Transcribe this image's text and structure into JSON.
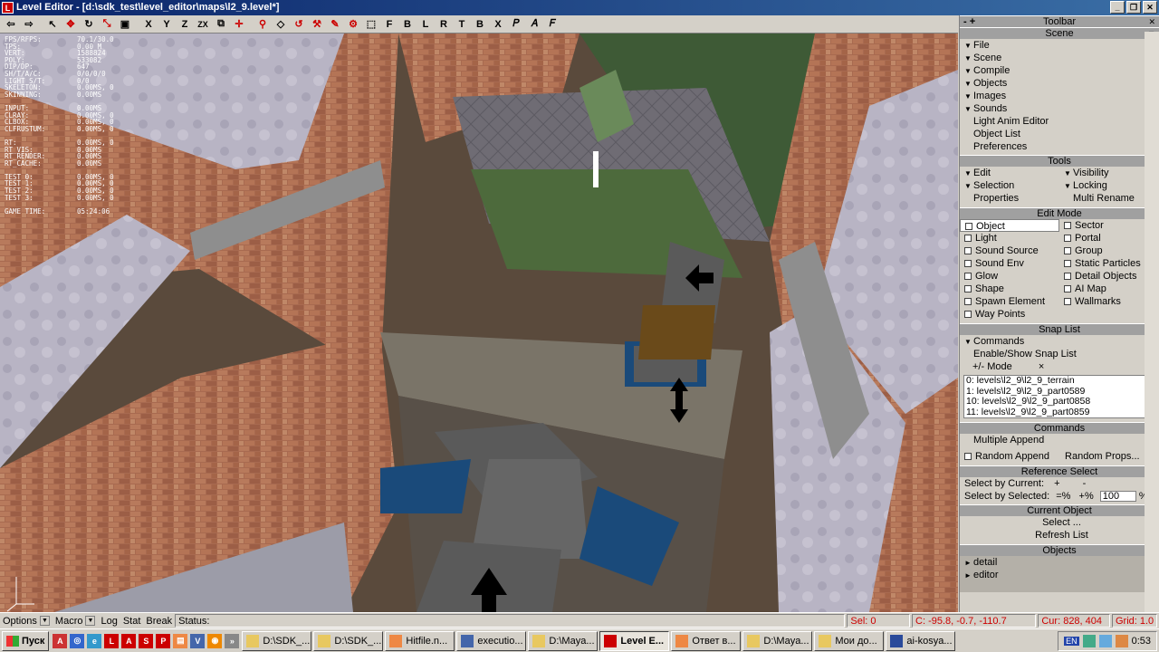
{
  "window": {
    "title": "Level Editor - [d:\\sdk_test\\level_editor\\maps\\l2_9.level*]",
    "app_icon": "L"
  },
  "toolbar": {
    "text_buttons": [
      "X",
      "Y",
      "Z",
      "ZX"
    ],
    "letter_buttons": [
      "F",
      "B",
      "L",
      "R",
      "T",
      "B",
      "X"
    ]
  },
  "stats": [
    [
      "FPS/RFPS:",
      "70.1/30.0"
    ],
    [
      "TPS:",
      "0.00 M"
    ],
    [
      "VERT:",
      "1588824"
    ],
    [
      "POLY:",
      "533082"
    ],
    [
      "DIP/DP:",
      "647"
    ],
    [
      "SH/T/A/C:",
      "0/0/0/0"
    ],
    [
      "LIGHT S/T:",
      "0/0"
    ],
    [
      "SKELETON:",
      "0.00MS, 0"
    ],
    [
      "SKINNING:",
      "0.00MS"
    ],
    [
      "",
      ""
    ],
    [
      "INPUT:",
      "0.00MS"
    ],
    [
      "CLRAY:",
      "0.00MS, 0"
    ],
    [
      "CLBOX:",
      "0.00MS, 0"
    ],
    [
      "CLFRUSTUM:",
      "0.00MS, 0"
    ],
    [
      "",
      ""
    ],
    [
      "RT:",
      "0.00MS, 0"
    ],
    [
      "RT_VIS:",
      "0.00MS"
    ],
    [
      "RT_RENDER:",
      "0.00MS"
    ],
    [
      "RT_CACHE:",
      "0.00MS"
    ],
    [
      "",
      ""
    ],
    [
      "TEST 0:",
      "0.00MS, 0"
    ],
    [
      "TEST 1:",
      "0.00MS, 0"
    ],
    [
      "TEST 2:",
      "0.00MS, 0"
    ],
    [
      "TEST 3:",
      "0.00MS, 0"
    ],
    [
      "",
      ""
    ],
    [
      "GAME TIME:",
      "05:24:06"
    ]
  ],
  "panel": {
    "title": "Toolbar",
    "scene": {
      "header": "Scene",
      "menus": [
        "File",
        "Scene",
        "Compile",
        "Objects",
        "Images",
        "Sounds"
      ],
      "items": [
        "Light Anim Editor",
        "Object List",
        "Preferences"
      ]
    },
    "tools": {
      "header": "Tools",
      "left": [
        "Edit",
        "Selection"
      ],
      "right": [
        "Visibility",
        "Locking"
      ],
      "properties": "Properties",
      "multi_rename": "Multi Rename"
    },
    "edit_mode": {
      "header": "Edit Mode",
      "left": [
        "Object",
        "Light",
        "Sound Source",
        "Sound Env",
        "Glow",
        "Shape",
        "Spawn Element",
        "Way Points"
      ],
      "right": [
        "Sector",
        "Portal",
        "Group",
        "Static Particles",
        "Detail Objects",
        "AI Map",
        "Wallmarks"
      ]
    },
    "snap": {
      "header": "Snap List",
      "commands": "Commands",
      "enable_show": "Enable/Show Snap List",
      "mode": "Mode",
      "mode_icon": "+/-",
      "close": "×",
      "items": [
        "0: levels\\l2_9\\l2_9_terrain",
        "1: levels\\l2_9\\l2_9_part0589",
        "10: levels\\l2_9\\l2_9_part0858",
        "11: levels\\l2_9\\l2_9_part0859"
      ]
    },
    "commands": {
      "header": "Commands",
      "multiple_append": "Multiple Append",
      "random_append": "Random Append",
      "random_props": "Random Props..."
    },
    "reference": {
      "header": "Reference Select",
      "by_current": "Select by Current:",
      "plus": "+",
      "minus": "-",
      "by_selected": "Select by Selected:",
      "eq_percent": "=%",
      "plus_percent": "+%",
      "value": "100",
      "percent": "%"
    },
    "current_object": {
      "header": "Current Object",
      "select": "Select ...",
      "refresh": "Refresh List"
    },
    "objects": {
      "header": "Objects",
      "items": [
        "detail",
        "editor"
      ]
    }
  },
  "statusbar": {
    "options": "Options",
    "macro": "Macro",
    "log": "Log",
    "stat": "Stat",
    "break": "Break",
    "status": "Status:",
    "sel": "Sel: 0",
    "coords": "C: -95.8, -0.7, -110.7",
    "cur": "Cur: 828, 404",
    "grid": "Grid: 1.0"
  },
  "taskbar": {
    "start": "Пуск",
    "tasks": [
      "D:\\SDK_...",
      "D:\\SDK_...",
      "Hitfile.n...",
      "executio...",
      "D:\\Maya...",
      "Level E...",
      "Ответ в...",
      "D:\\Maya...",
      "Мои до...",
      "ai-kosya..."
    ],
    "active_index": 5,
    "lang": "EN",
    "clock": "0:53"
  },
  "colors": {
    "titlebar": "#0a246a",
    "panel_header": "#a0a0a0",
    "red_text": "#cc0000"
  }
}
